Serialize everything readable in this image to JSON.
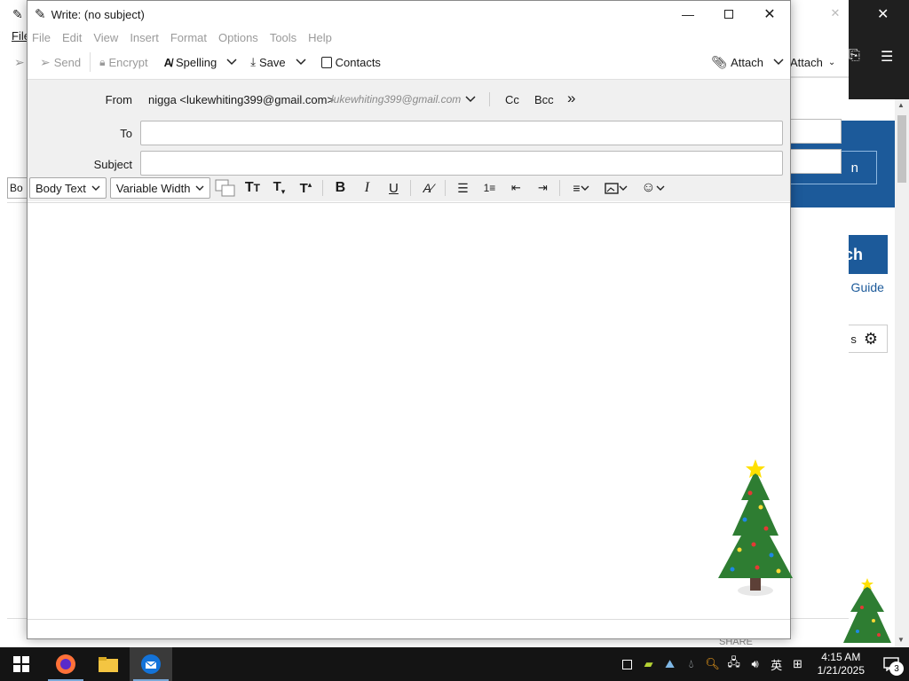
{
  "compose": {
    "title": "Write: (no subject)",
    "menu": [
      "File",
      "Edit",
      "View",
      "Insert",
      "Format",
      "Options",
      "Tools",
      "Help"
    ],
    "toolbar": {
      "send": "Send",
      "encrypt": "Encrypt",
      "spelling": "Spelling",
      "save": "Save",
      "contacts": "Contacts",
      "attach": "Attach"
    },
    "header": {
      "from_label": "From",
      "from_name": "nigga <lukewhiting399@gmail.com>",
      "from_email": "lukewhiting399@gmail.com",
      "cc": "Cc",
      "bcc": "Bcc",
      "to_label": "To",
      "to_value": "",
      "subject_label": "Subject",
      "subject_value": ""
    },
    "format": {
      "paragraph": "Body Text",
      "font": "Variable Width"
    },
    "body": ""
  },
  "background": {
    "menu_fragment": "File",
    "attach": "Attach",
    "search_fragment": "ch",
    "guide_fragment": "r Guide",
    "button_fragment": "n",
    "gear_fragment": "s",
    "share": "SHARE",
    "format_fragment": "Bo"
  },
  "taskbar": {
    "time": "4:15 AM",
    "date": "1/21/2025",
    "ime": "英",
    "notifications": "3"
  }
}
